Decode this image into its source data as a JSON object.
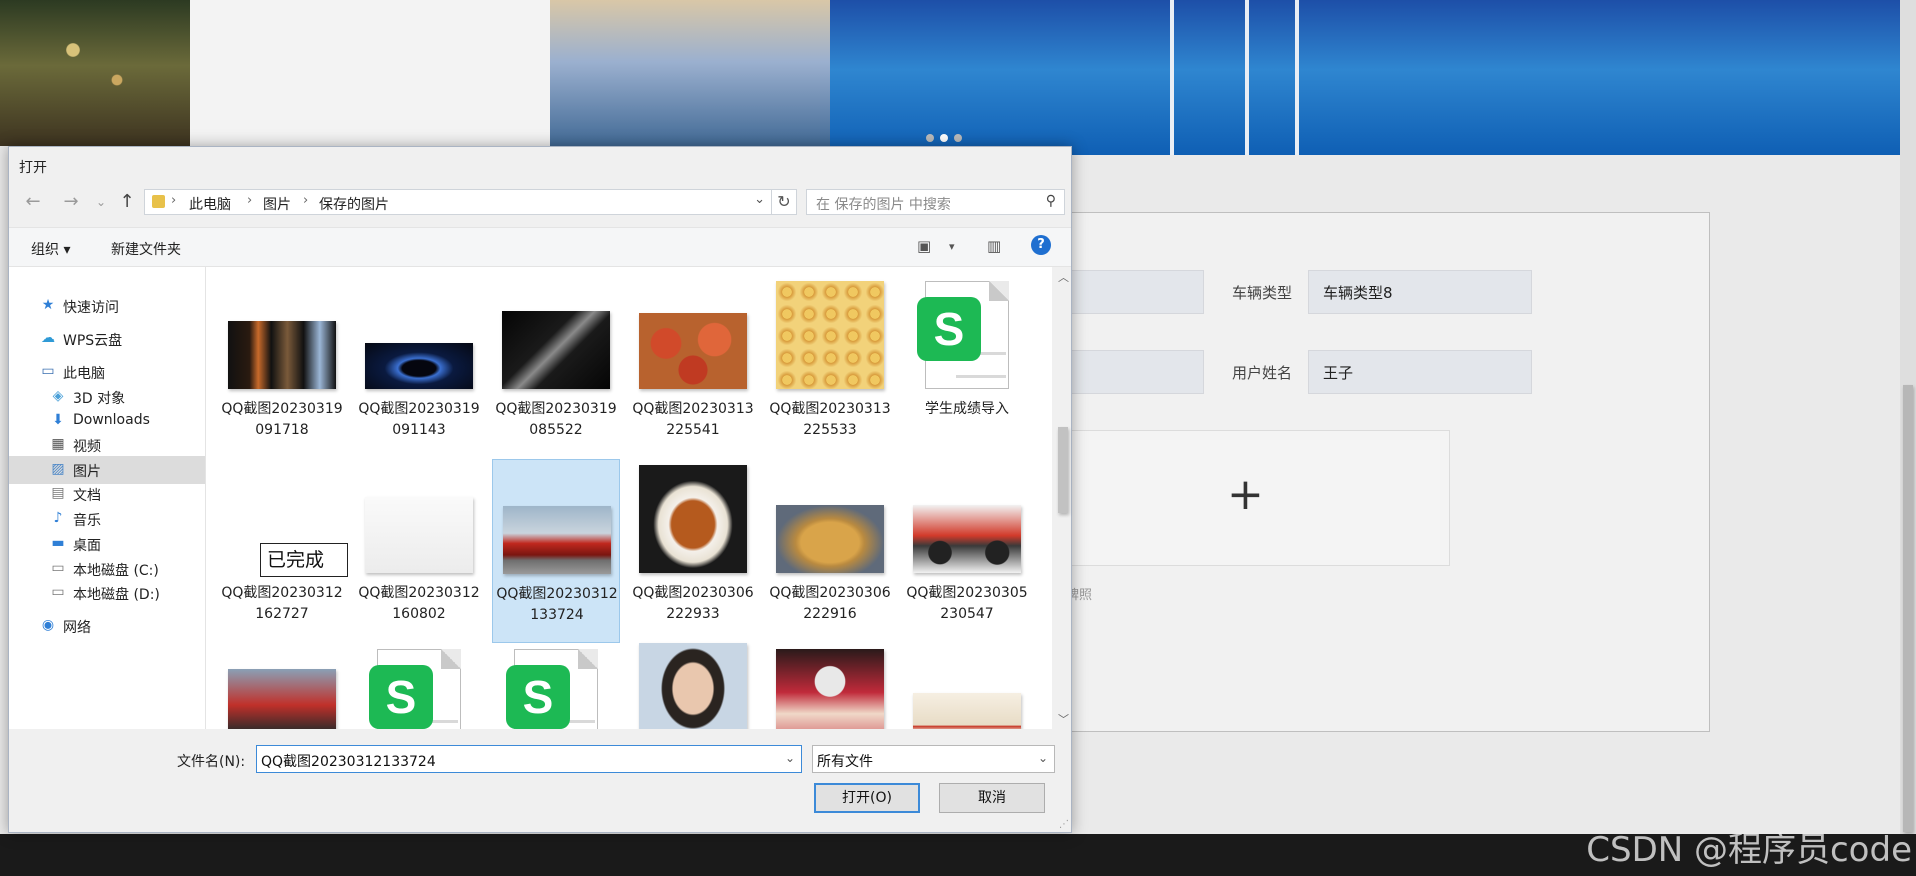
{
  "background": {
    "form": {
      "vehicle_type_label": "车辆类型",
      "vehicle_type_value": "车辆类型8",
      "user_name_label": "用户姓名",
      "user_name_value": "王子",
      "upload_plus": "+",
      "upload_hint": "牌照"
    },
    "watermark": "CSDN @程序员code"
  },
  "dialog": {
    "title": "打开",
    "nav": {
      "back": "←",
      "forward": "→",
      "recent": "⌄",
      "up": "↑"
    },
    "breadcrumb": [
      "此电脑",
      "图片",
      "保存的图片"
    ],
    "breadcrumb_sep": "›",
    "refresh": "↻",
    "search_placeholder": "在 保存的图片 中搜索",
    "toolbar": {
      "organize": "组织 ▾",
      "new_folder": "新建文件夹",
      "view_toggle": "▾",
      "help": "?"
    },
    "sidebar": [
      {
        "label": "快速访问",
        "icon": "star-icon",
        "glyph": "★",
        "color": "#2f7fd6"
      },
      {
        "label": "WPS云盘",
        "icon": "cloud-icon",
        "glyph": "☁",
        "color": "#2f9ad6"
      },
      {
        "label": "此电脑",
        "icon": "computer-icon",
        "glyph": "▭",
        "color": "#3a6fb0"
      },
      {
        "label": "3D 对象",
        "icon": "cube-icon",
        "glyph": "◈",
        "color": "#4aa0d8"
      },
      {
        "label": "Downloads",
        "icon": "download-icon",
        "glyph": "⬇",
        "color": "#2f7fd6"
      },
      {
        "label": "视频",
        "icon": "video-icon",
        "glyph": "▦",
        "color": "#555"
      },
      {
        "label": "图片",
        "icon": "pictures-icon",
        "glyph": "▨",
        "color": "#4a86c7",
        "active": true
      },
      {
        "label": "文档",
        "icon": "document-icon",
        "glyph": "▤",
        "color": "#777"
      },
      {
        "label": "音乐",
        "icon": "music-icon",
        "glyph": "♪",
        "color": "#2f7fd6"
      },
      {
        "label": "桌面",
        "icon": "desktop-icon",
        "glyph": "▬",
        "color": "#2f7fd6"
      },
      {
        "label": "本地磁盘 (C:)",
        "icon": "drive-c-icon",
        "glyph": "▭",
        "color": "#777"
      },
      {
        "label": "本地磁盘 (D:)",
        "icon": "drive-d-icon",
        "glyph": "▭",
        "color": "#777"
      },
      {
        "label": "网络",
        "icon": "network-icon",
        "glyph": "◉",
        "color": "#2f7fd6"
      }
    ],
    "files": [
      {
        "label": "QQ截图20230319091718",
        "thumb": "solar-system-thumbnail"
      },
      {
        "label": "QQ截图20230319091143",
        "thumb": "planet-thumbnail"
      },
      {
        "label": "QQ截图20230319085522",
        "thumb": "satellite-thumbnail"
      },
      {
        "label": "QQ截图20230313225541",
        "thumb": "apples-thumbnail"
      },
      {
        "label": "QQ截图20230313225533",
        "thumb": "fruit-box-thumbnail"
      },
      {
        "label": "学生成绩导入",
        "thumb": "wps-spreadsheet-icon"
      },
      {
        "label": "QQ截图20230312162727",
        "thumb": "renaming-file",
        "rename_text": "已完成"
      },
      {
        "label": "QQ截图20230312160802",
        "thumb": "qr-code-thumbnail"
      },
      {
        "label": "QQ截图20230312133724",
        "thumb": "red-car-thumbnail",
        "selected": true
      },
      {
        "label": "QQ截图20230306222933",
        "thumb": "roast-duck-thumbnail"
      },
      {
        "label": "QQ截图20230306222916",
        "thumb": "roast-chicken-thumbnail"
      },
      {
        "label": "QQ截图20230305230547",
        "thumb": "motorcycle-thumbnail"
      },
      {
        "label": "",
        "thumb": "scooter-thumbnail"
      },
      {
        "label": "",
        "thumb": "wps-spreadsheet-icon"
      },
      {
        "label": "",
        "thumb": "wps-spreadsheet-icon"
      },
      {
        "label": "",
        "thumb": "portrait-thumbnail"
      },
      {
        "label": "",
        "thumb": "pet-poster-thumbnail"
      },
      {
        "label": "",
        "thumb": "product-thumbnail"
      }
    ],
    "filename_label": "文件名(N):",
    "filename_value": "QQ截图20230312133724",
    "filetype_value": "所有文件",
    "open_button": "打开(O)",
    "cancel_button": "取消"
  }
}
